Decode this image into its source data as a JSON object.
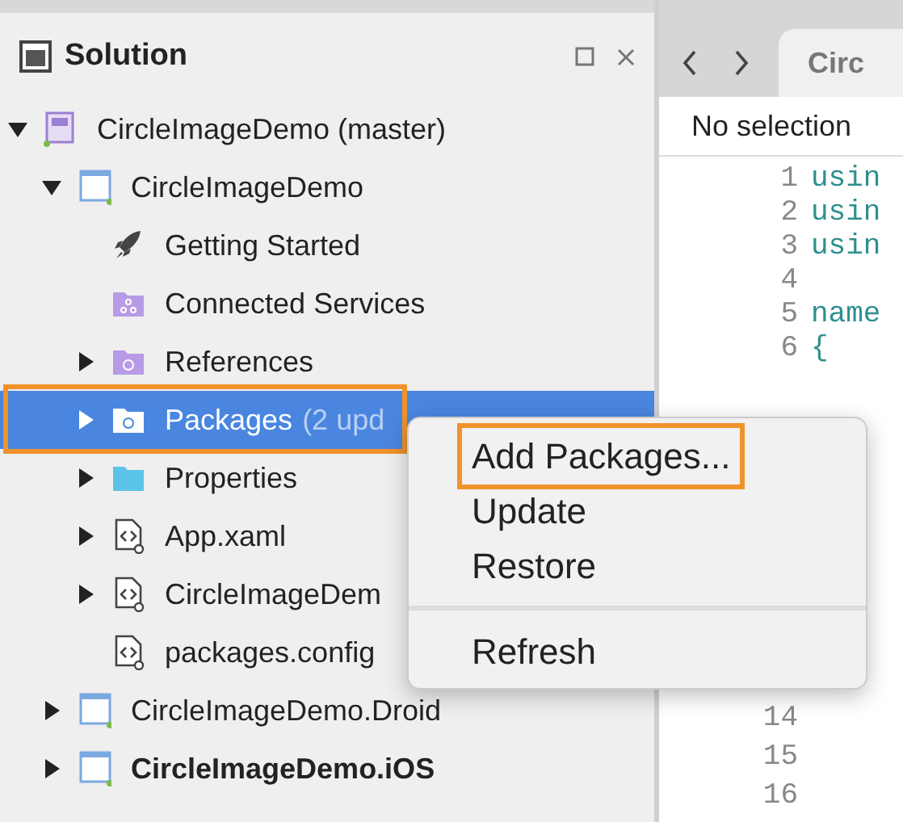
{
  "solution_pad": {
    "title": "Solution",
    "tree": [
      {
        "kind": "solution",
        "label": "CircleImageDemo (master)",
        "expanded": true,
        "selected": false,
        "children": [
          {
            "kind": "project",
            "label": "CircleImageDemo",
            "expanded": true,
            "selected": false,
            "children": [
              {
                "kind": "rocket",
                "label": "Getting Started",
                "selected": false
              },
              {
                "kind": "services",
                "label": "Connected Services",
                "selected": false
              },
              {
                "kind": "references",
                "label": "References",
                "expanded": false,
                "selected": false
              },
              {
                "kind": "packages",
                "label": "Packages",
                "badge": "(2 upd",
                "expanded": false,
                "selected": true,
                "outlined": true
              },
              {
                "kind": "folder",
                "label": "Properties",
                "expanded": false,
                "selected": false
              },
              {
                "kind": "xaml",
                "label": "App.xaml",
                "expanded": false,
                "selected": false
              },
              {
                "kind": "xaml",
                "label": "CircleImageDem",
                "expanded": false,
                "selected": false
              },
              {
                "kind": "xaml",
                "label": "packages.config",
                "selected": false
              }
            ]
          },
          {
            "kind": "project",
            "label": "CircleImageDemo.Droid",
            "expanded": false,
            "selected": false
          },
          {
            "kind": "project",
            "label": "CircleImageDemo.iOS",
            "expanded": false,
            "selected": false,
            "startup": true
          }
        ]
      }
    ]
  },
  "editor": {
    "tab": "Circ",
    "breadcrumb": "No selection",
    "lines_top": [
      {
        "number": "1",
        "code": "usin"
      },
      {
        "number": "2",
        "code": "usin"
      },
      {
        "number": "3",
        "code": "usin"
      },
      {
        "number": "4"
      },
      {
        "number": "5",
        "code": "name"
      },
      {
        "number": "6",
        "code": "{"
      }
    ],
    "lines_bottom": [
      {
        "number": "14"
      },
      {
        "number": "15"
      },
      {
        "number": "16"
      }
    ]
  },
  "context_menu": [
    {
      "kind": "item",
      "label": "Add Packages...",
      "outlined": true
    },
    {
      "kind": "item",
      "label": "Update"
    },
    {
      "kind": "item",
      "label": "Restore"
    },
    {
      "kind": "separator"
    },
    {
      "kind": "item",
      "label": "Refresh"
    }
  ]
}
